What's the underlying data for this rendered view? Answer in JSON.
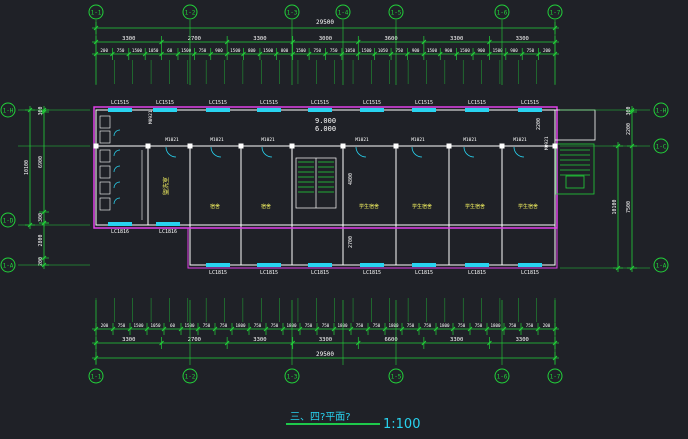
{
  "drawing": {
    "title": "三、四?平面?",
    "scale": "1:100",
    "colors": {
      "background": "#1f2127",
      "dim": "#22d13a",
      "axis": "#22d13a",
      "wall": "#ffffff",
      "cyan": "#28d3f0",
      "magenta": "#e040e8",
      "text_white": "#ffffff",
      "text_yellow": "#f2f060",
      "green_fill": "#1ec94b"
    },
    "top_axes": [
      "1-1",
      "1-2",
      "1-3",
      "1-4",
      "1-5",
      "1-6",
      "1-7"
    ],
    "bottom_axes": [
      "1-1",
      "1-2",
      "1-3",
      "1-5",
      "1-6",
      "1-7"
    ],
    "left_axes": [
      "1-H",
      "1-D",
      "1-A"
    ],
    "right_axes": [
      "1-H",
      "1-C",
      "1-A"
    ],
    "top_total": "29500",
    "top_spans": [
      "3300",
      "2700",
      "3300",
      "3000",
      "3600",
      "3300",
      "3300"
    ],
    "top_segments": [
      "200",
      "750",
      "1500",
      "1050",
      "60",
      "1500",
      "750",
      "900",
      "1500",
      "800",
      "1500",
      "800",
      "1500",
      "750",
      "750",
      "1050",
      "1500",
      "1050",
      "750",
      "900",
      "1500",
      "900",
      "1500",
      "900",
      "1500",
      "900",
      "750",
      "200"
    ],
    "bottom_total": "29500",
    "bottom_spans": [
      "3300",
      "2700",
      "3300",
      "3300",
      "6600",
      "3300",
      "3300"
    ],
    "bottom_segments": [
      "200",
      "750",
      "1500",
      "1050",
      "60",
      "1500",
      "750",
      "750",
      "1800",
      "750",
      "750",
      "1800",
      "750",
      "750",
      "1800",
      "750",
      "750",
      "1800",
      "750",
      "750",
      "1800",
      "750",
      "750",
      "1800",
      "750",
      "750",
      "200"
    ],
    "left_dims": [
      "300",
      "6900",
      "10100",
      "300",
      "2800",
      "200"
    ],
    "right_dims": [
      "300",
      "2200",
      "10100",
      "7500",
      "200"
    ],
    "windows_top": [
      "LC1515",
      "LC1515",
      "LC1515",
      "LC1515",
      "LC1515",
      "LC1515",
      "LC1515",
      "LC1515",
      "LC1515"
    ],
    "windows_bottom": [
      "LC1816",
      "LC1816",
      "LC1815",
      "LC1815",
      "LC1815",
      "LC1815",
      "LC1815",
      "LC1815",
      "LC1815"
    ],
    "doors": [
      "M1021",
      "M1021",
      "M1021",
      "M1021",
      "M1021",
      "M1021",
      "M1021",
      "M1021"
    ],
    "door_m0921": "M0921",
    "door_side": "M0921",
    "elev_a": "9.000",
    "elev_b": "6.000",
    "stair_dim_a": "4800",
    "stair_dim_b": "2700",
    "right_dim_a": "2200",
    "room_washroom": "盥洗室",
    "rooms": [
      "宿舍",
      "宿舍",
      "学生宿舍",
      "学生宿舍",
      "学生宿舍",
      "学生宿舍"
    ]
  }
}
